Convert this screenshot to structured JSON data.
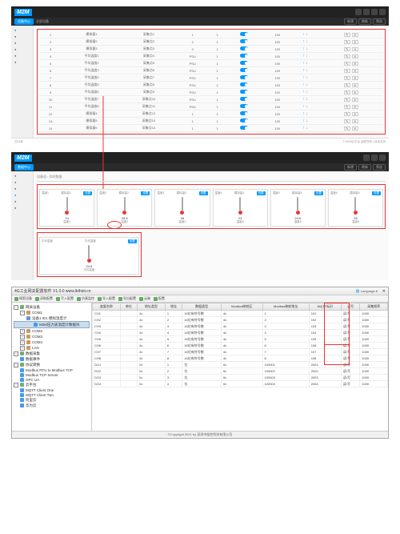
{
  "panel1": {
    "logo": "M2M",
    "tab": "设备中心",
    "breadcrumb": "全部设备",
    "headerButtons": [
      "新建",
      "刷新",
      "筛选"
    ],
    "rows": [
      {
        "c1": "1",
        "c2": "模拟量1",
        "c3": "采集点1",
        "c4": "1",
        "c5": "1",
        "c6": "100",
        "c7": "℃"
      },
      {
        "c1": "2",
        "c2": "模拟量2",
        "c3": "采集点2",
        "c4": "2",
        "c5": "1",
        "c6": "100",
        "c7": "℃"
      },
      {
        "c1": "3",
        "c2": "模拟量3",
        "c3": "采集点3",
        "c4": "3",
        "c5": "1",
        "c6": "100",
        "c7": "℃"
      },
      {
        "c1": "4",
        "c2": "平均温度1",
        "c3": "采集点4",
        "c4": "PSU",
        "c5": "1",
        "c6": "100",
        "c7": "℃"
      },
      {
        "c1": "5",
        "c2": "平均温度2",
        "c3": "采集点5",
        "c4": "PSU",
        "c5": "1",
        "c6": "100",
        "c7": "℃"
      },
      {
        "c1": "6",
        "c2": "平均温度3",
        "c3": "采集点6",
        "c4": "PSU",
        "c5": "1",
        "c6": "100",
        "c7": "℃"
      },
      {
        "c1": "7",
        "c2": "平均温度4",
        "c3": "采集点7",
        "c4": "PSU",
        "c5": "1",
        "c6": "100",
        "c7": "℃"
      },
      {
        "c1": "8",
        "c2": "平均温度5",
        "c3": "采集点8",
        "c4": "PSU",
        "c5": "1",
        "c6": "100",
        "c7": "℃"
      },
      {
        "c1": "9",
        "c2": "平均温度6",
        "c3": "采集点9",
        "c4": "PSU",
        "c5": "1",
        "c6": "100",
        "c7": "℃"
      },
      {
        "c1": "10",
        "c2": "平均温度7",
        "c3": "采集点10",
        "c4": "PSU",
        "c5": "1",
        "c6": "100",
        "c7": "℃"
      },
      {
        "c1": "11",
        "c2": "平均温度8",
        "c3": "采集点11",
        "c4": "PSU",
        "c5": "1",
        "c6": "100",
        "c7": "℃"
      },
      {
        "c1": "12",
        "c2": "模拟量4",
        "c3": "采集点12",
        "c4": "1",
        "c5": "1",
        "c6": "100",
        "c7": "℃"
      },
      {
        "c1": "13",
        "c2": "模拟量5",
        "c3": "采集点13",
        "c4": "1",
        "c5": "1",
        "c6": "100",
        "c7": "℃"
      },
      {
        "c1": "14",
        "c2": "模拟量6",
        "c3": "采集点14",
        "c4": "1",
        "c5": "1",
        "c6": "100",
        "c7": "℃"
      }
    ],
    "footerLeft": "共14条",
    "footerRight": "© M2M云平台 版权所有 | 技术支持"
  },
  "panel2": {
    "logo": "M2M",
    "tab": "数据中心",
    "crumb1": "设备组",
    "crumb2": "实时数据",
    "headerButtons": [
      "新建",
      "刷新",
      "筛选"
    ],
    "gauges": [
      {
        "name": "温度1",
        "opt": "模拟量1",
        "val": "24",
        "btn": "设置"
      },
      {
        "name": "温度2",
        "opt": "模拟量2",
        "val": "25.5",
        "btn": "设置"
      },
      {
        "name": "温度3",
        "opt": "模拟量3",
        "val": "26",
        "btn": "设置"
      },
      {
        "name": "温度4",
        "opt": "模拟量4",
        "val": "23",
        "btn": "设置"
      },
      {
        "name": "温度5",
        "opt": "模拟量5",
        "val": "24.5",
        "btn": "设置"
      },
      {
        "name": "温度6",
        "opt": "模拟量6",
        "val": "25",
        "btn": "设置"
      }
    ],
    "gauges2": [
      {
        "name": "平均温度",
        "opt": "平均温度",
        "val": "24.5",
        "btn": "设置"
      }
    ]
  },
  "panel3": {
    "title": "4G工业网关配置软件 V1.0.0 www.lkthiot.cn",
    "lang": "Language",
    "toolbar": [
      {
        "icon": "search",
        "label": "搜索设备"
      },
      {
        "icon": "download",
        "label": "读取配置"
      },
      {
        "icon": "upload",
        "label": "写入配置"
      },
      {
        "icon": "sim",
        "label": "仿真监控"
      },
      {
        "icon": "import",
        "label": "导入配置"
      },
      {
        "icon": "export",
        "label": "导出配置"
      },
      {
        "icon": "cloud",
        "label": "云端"
      },
      {
        "icon": "settings",
        "label": "配置"
      }
    ],
    "tree": {
      "root": "网关设备",
      "com": [
        "COM1",
        "COM2",
        "COM3",
        "COM4"
      ],
      "dev": {
        "name": "设备1  ID1  模拟温度计",
        "sub": "M2M压力表温度计数据块"
      },
      "lan": "LAN",
      "groups": [
        {
          "name": "数据采集",
          "children": [
            "数据事件"
          ]
        },
        {
          "name": "协议转换",
          "children": [
            "Modbus RTU to Modbus TCP",
            "Modbus TCP Server",
            "OPC UA"
          ]
        },
        {
          "name": "云平台",
          "children": [
            "MQTT Client One",
            "MQTT Client Two",
            "阿里云",
            "华为云"
          ]
        }
      ]
    },
    "gridHeaders": [
      "变量名称",
      "单位",
      "地址类型",
      "地址",
      "数据类型",
      "Modbus映射区",
      "Modbus映射地址",
      "MQTT标识",
      "读写",
      "采集频率"
    ],
    "gridRows": [
      {
        "n": "CH1",
        "u": "",
        "at": "4x",
        "a": "1",
        "dt": "16位有符号数",
        "mr": "4x",
        "ma": "1",
        "mq": "101",
        "rw": "读/写",
        "f": "1000"
      },
      {
        "n": "CH2",
        "u": "",
        "at": "4x",
        "a": "2",
        "dt": "16位有符号数",
        "mr": "4x",
        "ma": "2",
        "mq": "102",
        "rw": "读/写",
        "f": "1000"
      },
      {
        "n": "CH3",
        "u": "",
        "at": "4x",
        "a": "3",
        "dt": "16位有符号数",
        "mr": "4x",
        "ma": "3",
        "mq": "103",
        "rw": "读/写",
        "f": "1000"
      },
      {
        "n": "CH4",
        "u": "",
        "at": "4x",
        "a": "4",
        "dt": "16位有符号数",
        "mr": "4x",
        "ma": "4",
        "mq": "104",
        "rw": "读/写",
        "f": "1000"
      },
      {
        "n": "CH5",
        "u": "",
        "at": "4x",
        "a": "5",
        "dt": "16位有符号数",
        "mr": "4x",
        "ma": "5",
        "mq": "105",
        "rw": "读/写",
        "f": "1000"
      },
      {
        "n": "CH6",
        "u": "",
        "at": "4x",
        "a": "6",
        "dt": "16位有符号数",
        "mr": "4x",
        "ma": "6",
        "mq": "106",
        "rw": "读/写",
        "f": "1000"
      },
      {
        "n": "CH7",
        "u": "",
        "at": "4x",
        "a": "7",
        "dt": "16位有符号数",
        "mr": "4x",
        "ma": "7",
        "mq": "107",
        "rw": "读/写",
        "f": "1000"
      },
      {
        "n": "CH8",
        "u": "",
        "at": "4x",
        "a": "8",
        "dt": "16位有符号数",
        "mr": "4x",
        "ma": "8",
        "mq": "108",
        "rw": "读/写",
        "f": "1000"
      },
      {
        "n": "DO1",
        "u": "",
        "at": "0x",
        "a": "1",
        "dt": "位",
        "mr": "0x",
        "ma": "100001",
        "mq": "2001",
        "rw": "读/写",
        "f": "1000"
      },
      {
        "n": "DO2",
        "u": "",
        "at": "0x",
        "a": "2",
        "dt": "位",
        "mr": "0x",
        "ma": "100002",
        "mq": "2002",
        "rw": "读/写",
        "f": "1000"
      },
      {
        "n": "DO3",
        "u": "",
        "at": "0x",
        "a": "3",
        "dt": "位",
        "mr": "0x",
        "ma": "100003",
        "mq": "2003",
        "rw": "读/写",
        "f": "1000"
      },
      {
        "n": "DO4",
        "u": "",
        "at": "0x",
        "a": "4",
        "dt": "位",
        "mr": "0x",
        "ma": "100004",
        "mq": "2004",
        "rw": "读/写",
        "f": "1000"
      }
    ],
    "status": "©Copyright 2021 by 深圳市链控科技有限公司"
  }
}
